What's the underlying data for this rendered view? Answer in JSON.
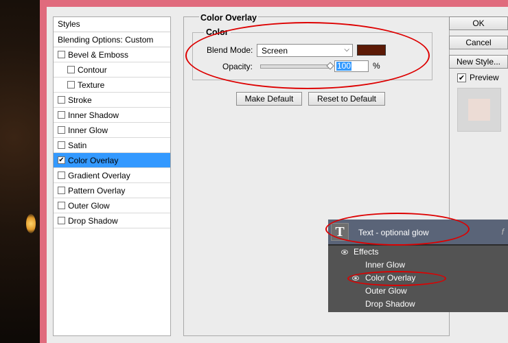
{
  "styles_panel": {
    "header": "Styles",
    "blending_options": "Blending Options: Custom",
    "items": [
      {
        "label": "Bevel & Emboss",
        "checked": false,
        "sub": false,
        "selected": false
      },
      {
        "label": "Contour",
        "checked": false,
        "sub": true,
        "selected": false
      },
      {
        "label": "Texture",
        "checked": false,
        "sub": true,
        "selected": false
      },
      {
        "label": "Stroke",
        "checked": false,
        "sub": false,
        "selected": false
      },
      {
        "label": "Inner Shadow",
        "checked": false,
        "sub": false,
        "selected": false
      },
      {
        "label": "Inner Glow",
        "checked": false,
        "sub": false,
        "selected": false
      },
      {
        "label": "Satin",
        "checked": false,
        "sub": false,
        "selected": false
      },
      {
        "label": "Color Overlay",
        "checked": true,
        "sub": false,
        "selected": true
      },
      {
        "label": "Gradient Overlay",
        "checked": false,
        "sub": false,
        "selected": false
      },
      {
        "label": "Pattern Overlay",
        "checked": false,
        "sub": false,
        "selected": false
      },
      {
        "label": "Outer Glow",
        "checked": false,
        "sub": false,
        "selected": false
      },
      {
        "label": "Drop Shadow",
        "checked": false,
        "sub": false,
        "selected": false
      }
    ]
  },
  "color_overlay": {
    "title": "Color Overlay",
    "group_title": "Color",
    "blend_mode_label": "Blend Mode:",
    "blend_mode_value": "Screen",
    "swatch_color": "#5c1a06",
    "opacity_label": "Opacity:",
    "opacity_value": "100",
    "opacity_unit": "%",
    "opacity_fraction": 1.0,
    "make_default": "Make Default",
    "reset_default": "Reset to Default"
  },
  "dialog_buttons": {
    "ok": "OK",
    "cancel": "Cancel",
    "new_style": "New Style...",
    "preview_label": "Preview",
    "preview_checked": true
  },
  "layers_panel": {
    "thumb_letter": "T",
    "layer_name": "Text - optional glow",
    "fx": "f",
    "effects_label": "Effects",
    "effects": [
      "Inner Glow",
      "Color Overlay",
      "Outer Glow",
      "Drop Shadow"
    ]
  },
  "colors": {
    "selection": "#3399ff",
    "highlight_ring": "#dd0000",
    "frame": "#e06b7d"
  }
}
